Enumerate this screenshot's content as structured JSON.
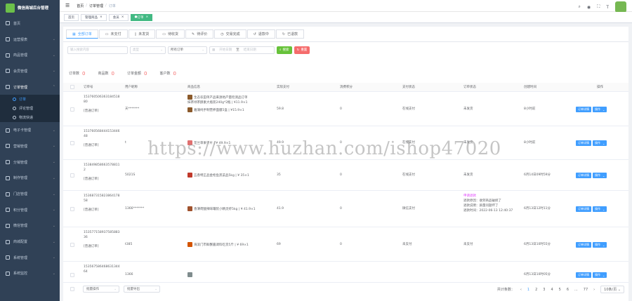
{
  "app": {
    "title": "微信商城后台管理"
  },
  "sidebar": {
    "items": [
      {
        "label": "首页"
      },
      {
        "label": "运营报表"
      },
      {
        "label": "商品管理"
      },
      {
        "label": "会员管理"
      },
      {
        "label": "订单管理",
        "expanded": true
      }
    ],
    "sub_items": [
      {
        "label": "订单",
        "active": true
      },
      {
        "label": "评论管理"
      },
      {
        "label": "物流快递"
      }
    ],
    "items_after": [
      {
        "label": "电子卡管理"
      },
      {
        "label": "营销管理"
      },
      {
        "label": "分销管理"
      },
      {
        "label": "制作管理"
      },
      {
        "label": "门店管理"
      },
      {
        "label": "积分管理"
      },
      {
        "label": "微信管理"
      },
      {
        "label": "商城配置"
      },
      {
        "label": "系统管理"
      },
      {
        "label": "系统监控"
      }
    ]
  },
  "breadcrumb": {
    "home": "首页",
    "level1": "订单管理",
    "current": "订单"
  },
  "tags": [
    {
      "label": "首页",
      "active": false
    },
    {
      "label": "管理商品",
      "active": false
    },
    {
      "label": "会员",
      "active": false
    },
    {
      "label": "订单",
      "active": true
    }
  ],
  "tabs": [
    {
      "label": "全部订单",
      "active": true
    },
    {
      "label": "未支付"
    },
    {
      "label": "未发货"
    },
    {
      "label": "待收货"
    },
    {
      "label": "待评价"
    },
    {
      "label": "交易完成"
    },
    {
      "label": "退款中"
    },
    {
      "label": "已退款"
    }
  ],
  "filters": {
    "search_placeholder": "输入搜索内容",
    "type_placeholder": "类型",
    "order_type_value": "所有订单",
    "start_placeholder": "开始日期",
    "date_sep": "至",
    "end_placeholder": "结束日期",
    "search_btn": "搜索",
    "reset_btn": "重置"
  },
  "stats": [
    {
      "label": "订单数",
      "value": "0"
    },
    {
      "label": "商品数",
      "value": "0"
    },
    {
      "label": "订单金额",
      "value": "0"
    },
    {
      "label": "客户数",
      "value": "0"
    }
  ],
  "table": {
    "columns": [
      "订单号",
      "用户昵称",
      "商品信息",
      "实际支付",
      "消费积分",
      "支付状态",
      "订单状态",
      "创建时间",
      "操作"
    ],
    "rows": [
      {
        "order_no_1": "153760506363184518",
        "order_no_2": "80",
        "type": "[普通订单]",
        "user": "天*******",
        "goods": [
          "生态农田单产品来源地产量检测品订单",
          "抹茶绿茶酵素大瓶装240g*2瓶 | ¥11.9×1",
          "雅蒲纯手制营养面膜5盒 | ¥15.9×1"
        ],
        "pay": "59.8",
        "points": "0",
        "pay_status": "在线支付",
        "status": "未发货",
        "time": "8小时前",
        "detail": "订单详情",
        "action": "操作"
      },
      {
        "order_no_1": "153760568444153446",
        "order_no_2": "48",
        "type": "[普通订单]",
        "user": "t",
        "goods": [
          "花兰草果干片 | ¥ 49.9×1"
        ],
        "pay": "49.9",
        "points": "0",
        "pay_status": "在线支付",
        "status": "未发货",
        "time": "8小时前",
        "detail": "订单详情",
        "action": "操作"
      },
      {
        "order_no_1": "153849858663578811",
        "order_no_2": "2",
        "type": "[普通订单]",
        "user": "5021S",
        "goods": [
          "五香特正品金枪鱼黑菜品5kg | ¥ 35×1"
        ],
        "pay": "35",
        "points": "0",
        "pay_status": "在线支付",
        "status": "未发货",
        "time": "6月14日09时59分",
        "detail": "订单详情",
        "action": "操作"
      },
      {
        "order_no_1": "153687315823864178",
        "order_no_2": "58",
        "type": "[普通订单]",
        "user": "1366*******",
        "goods": [
          "香薄荷酸辣味罐装小精灵虾5kg | ¥ 41.9×1"
        ],
        "pay": "41.9",
        "points": "0",
        "pay_status": "微信支付",
        "status": "",
        "refund_lines": [
          "申请退款",
          "退款原因：收到商品破损了",
          "退款说明：质量问题坏了",
          "退款时间：2022-06-13 12:40:37"
        ],
        "time": "6月13日12时11分",
        "detail": "订单详情",
        "action": "操作"
      },
      {
        "order_no_1": "153577158937585883",
        "order_no_2": "36",
        "type": "[普通订单]",
        "user": "t385",
        "goods": [
          "海滨门市鲜蟹酱调料吃货5斤 | ¥ 69×1"
        ],
        "pay": "69",
        "points": "0",
        "pay_status": "未支付",
        "status": "未支付",
        "time": "6月13日10时55分",
        "detail": "订单详情",
        "action": "操作"
      },
      {
        "order_no_1": "153567586468631344",
        "order_no_2": "64",
        "type": "",
        "user": "1366",
        "goods": [
          ""
        ],
        "pay": "",
        "points": "",
        "pay_status": "",
        "status": "",
        "time": "6月13日10时05分",
        "detail": "订单详情",
        "action": "操作"
      }
    ]
  },
  "footer": {
    "batch_action": "批量操作",
    "batch_export": "批量导出",
    "total_label": "共计条数：",
    "pages": [
      "1",
      "2",
      "3",
      "4",
      "5",
      "6",
      "...",
      "77"
    ],
    "current_page": "1",
    "page_size": "10条/页"
  },
  "watermark": "https://www.huzhan.com/ishop47020",
  "colors": {
    "sidebar": "#304156",
    "primary": "#409eff",
    "success": "#67c23a",
    "danger": "#f56c6c",
    "tag_active": "#42b983"
  }
}
